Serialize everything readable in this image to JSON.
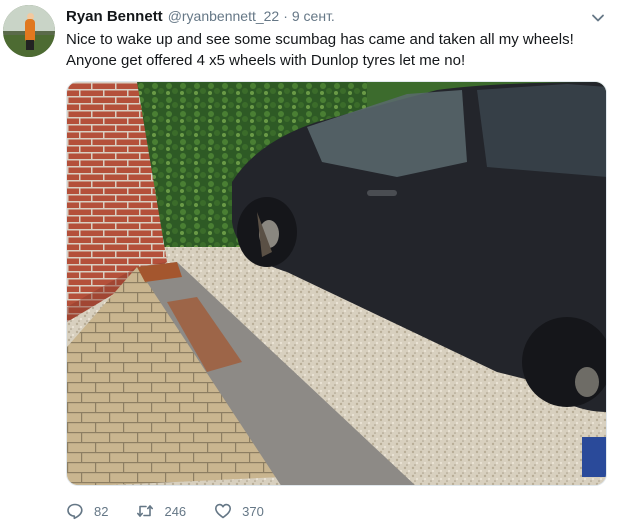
{
  "tweet": {
    "author_name": "Ryan Bennett",
    "author_handle": "@ryanbennett_22",
    "separator": "·",
    "date": "9 сент.",
    "text_lines": [
      "Nice to wake up and see some scumbag has came and taken all my wheels!",
      "Anyone get offered 4 x5 wheels with Dunlop tyres let me no!"
    ],
    "media_icon": "photo-car-missing-wheels",
    "menu_icon": "chevron-down-icon"
  },
  "actions": {
    "replies": {
      "icon": "reply-icon",
      "count": "82"
    },
    "retweets": {
      "icon": "retweet-icon",
      "count": "246"
    },
    "likes": {
      "icon": "heart-icon",
      "count": "370"
    }
  },
  "colors": {
    "text_primary": "#14171a",
    "text_secondary": "#657786",
    "icon_gray": "#657786"
  }
}
